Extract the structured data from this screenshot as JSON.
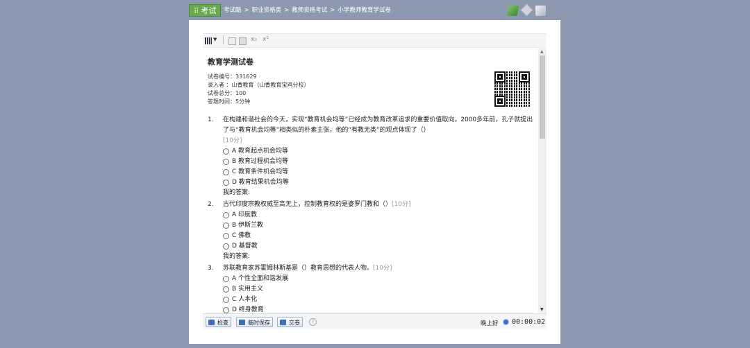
{
  "header": {
    "brand": "考试",
    "brand_icon": "grid-icon",
    "breadcrumbs": [
      "考试酷",
      "职业资格类",
      "教师资格考试",
      "小学教师教育学试卷"
    ],
    "separator": ">",
    "icons": [
      "book-icon",
      "diamond-icon",
      "pen-icon"
    ]
  },
  "toolbar": {
    "subscript": "x₂",
    "superscript": "x²"
  },
  "exam": {
    "title": "教育学测试卷",
    "meta": [
      "试卷编号：331629",
      "录入者 ：山香教育（山香教育宝鸡分校）",
      "试卷总分：100",
      "答题时间：5分钟"
    ]
  },
  "questions": [
    {
      "num": "1.",
      "text": "在构建和谐社会的今天，实现“教育机会均等”已经成为教育改革追求的重要价值取向，2000多年前，孔子就提出了与“教育机会均等”相类似的朴素主张，他的“有教无类”的观点体现了（）",
      "score": "[10分]",
      "options": [
        "A 教育起点机会均等",
        "B 教育过程机会均等",
        "C 教育条件机会均等",
        "D 教育结果机会均等"
      ],
      "answer_label": "我的答案:"
    },
    {
      "num": "2.",
      "text": "古代印度宗教权威至高无上，控制教育权的是婆罗门教和（）",
      "score": "[10分]",
      "options": [
        "A 印度教",
        "B 伊斯兰教",
        "C 佛教",
        "D 基督教"
      ],
      "answer_label": "我的答案:"
    },
    {
      "num": "3.",
      "text": "苏联教育家苏霍姆林斯基是（）教育思想的代表人物。",
      "score": "[10分]",
      "options": [
        "A 个性全面和谐发展",
        "B 实用主义",
        "C 人本化",
        "D 终身教育"
      ],
      "answer_label": ""
    }
  ],
  "bottom": {
    "check_label": "检查",
    "save_label": "临时保存",
    "submit_label": "交卷",
    "help": "?",
    "greeting": "晚上好",
    "timer": "00:00:02"
  }
}
